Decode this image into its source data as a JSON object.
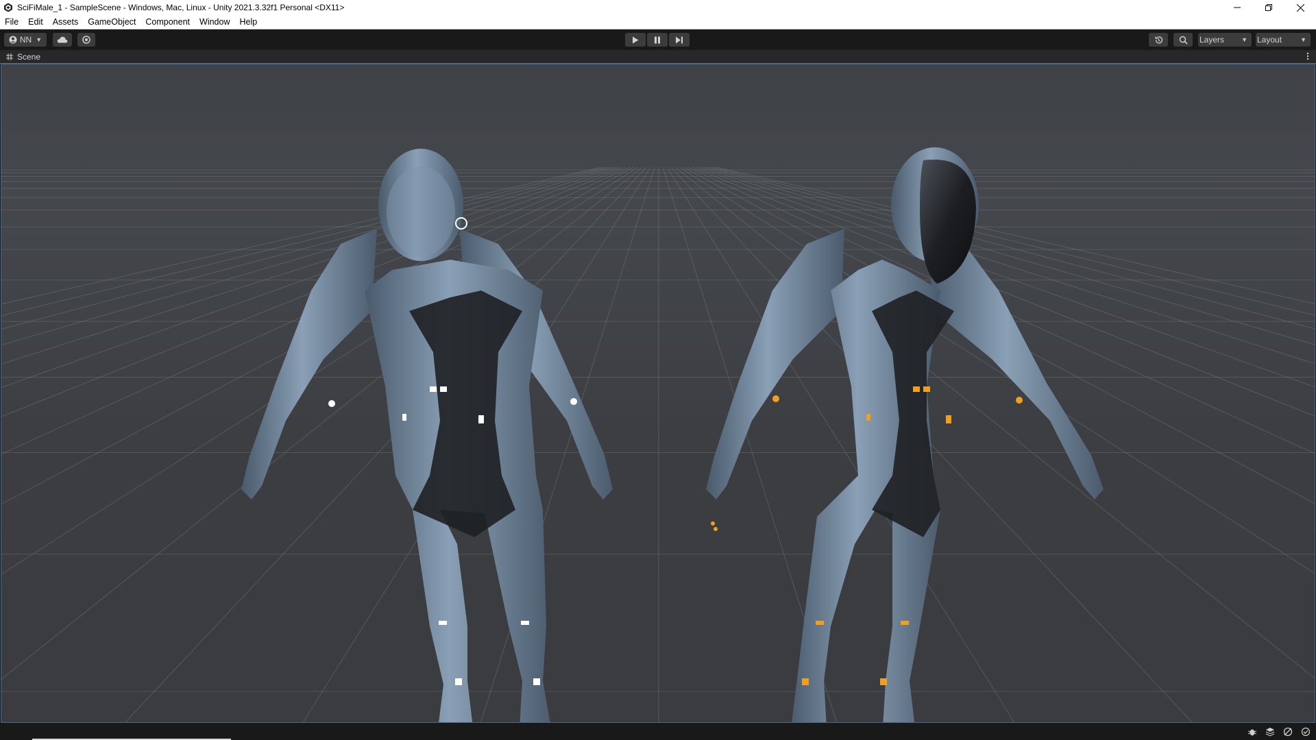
{
  "window": {
    "title": "SciFiMale_1 - SampleScene - Windows, Mac, Linux - Unity 2021.3.32f1 Personal <DX11>",
    "controls": [
      "minimize-icon",
      "restore-icon",
      "close-icon"
    ]
  },
  "menu": {
    "items": [
      {
        "label": "File"
      },
      {
        "label": "Edit"
      },
      {
        "label": "Assets"
      },
      {
        "label": "GameObject"
      },
      {
        "label": "Component"
      },
      {
        "label": "Window"
      },
      {
        "label": "Help"
      }
    ]
  },
  "toolbar": {
    "account_label": "NN",
    "account_icon": "account-icon",
    "cloud_icon": "cloud-icon",
    "collab_icon": "collab-icon",
    "play_icon": "play-icon",
    "pause_icon": "pause-icon",
    "step_icon": "step-icon",
    "history_icon": "undo-history-icon",
    "search_icon": "search-icon",
    "layers_label": "Layers",
    "layout_label": "Layout"
  },
  "scene_tab": {
    "label": "Scene",
    "icon": "scene-grid-icon"
  },
  "scene": {
    "characters": [
      {
        "name": "scifi-character-white-lights",
        "accent": "#ffffff"
      },
      {
        "name": "scifi-character-orange-lights",
        "accent": "#f0a020"
      }
    ],
    "suit_color": "#6f859c",
    "dark_color": "#1e2024"
  },
  "status": {
    "icons": [
      "debug-icon",
      "layers-status-icon",
      "cache-icon",
      "checkmark-icon"
    ]
  }
}
